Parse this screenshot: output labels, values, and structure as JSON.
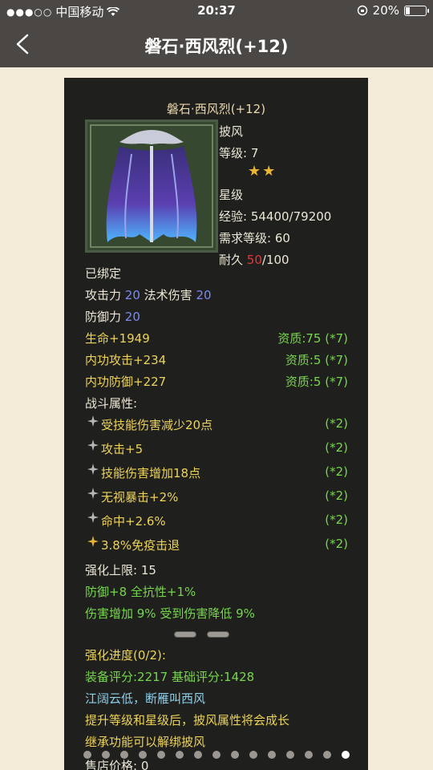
{
  "status_bar": {
    "carrier": "中国移动",
    "time": "20:37",
    "battery": "20%",
    "battery_level": 0.2
  },
  "nav": {
    "title": "磐石·西风烈(+12)"
  },
  "item": {
    "name": "磐石·西风烈(+12)",
    "type": "披风",
    "level_label": "等级:",
    "level_value": "7",
    "star_count": 2,
    "star_label": "星级",
    "exp_label": "经验:",
    "exp_value": "54400/79200",
    "req_level_label": "需求等级:",
    "req_level_value": "60",
    "durability_label": "耐久",
    "durability_current": "50",
    "durability_max": "/100",
    "bound": "已绑定",
    "atk_label": "攻击力",
    "atk_value": "20",
    "magic_label": "法术伤害",
    "magic_value": "20",
    "def_label": "防御力",
    "def_value": "20",
    "attrs": [
      {
        "name": "生命+1949",
        "quality": "资质:75 (*7)"
      },
      {
        "name": "内功攻击+234",
        "quality": "资质:5 (*7)"
      },
      {
        "name": "内功防御+227",
        "quality": "资质:5 (*7)"
      }
    ],
    "battle_header": "战斗属性:",
    "battle_attrs": [
      {
        "name": "受技能伤害减少20点",
        "mult": "(*2)",
        "icon": "gray-star-icon"
      },
      {
        "name": "攻击+5",
        "mult": "(*2)",
        "icon": "gray-star-icon"
      },
      {
        "name": "技能伤害增加18点",
        "mult": "(*2)",
        "icon": "gray-star-icon"
      },
      {
        "name": "无视暴击+2%",
        "mult": "(*2)",
        "icon": "gray-star-icon"
      },
      {
        "name": "命中+2.6%",
        "mult": "(*2)",
        "icon": "gray-star-icon"
      },
      {
        "name": "3.8%免疫击退",
        "mult": "(*2)",
        "icon": "gold-star-icon"
      }
    ],
    "enhance_limit_label": "强化上限:",
    "enhance_limit_value": "15",
    "enhance_bonus_1": "防御+8 全抗性+1%",
    "enhance_bonus_2": "伤害增加 9% 受到伤害降低 9%",
    "enhance_progress": "强化进度(0/2):",
    "score": "装备评分:2217 基础评分:1428",
    "flavor": "江阔云低，断雁叫西风",
    "note_1": "提升等级和星级后，披风属性将会成长",
    "note_2": "继承功能可以解绑披风",
    "sell_label": "售店价格:",
    "sell_value": "0"
  },
  "pager": {
    "total": 15,
    "active": 14
  }
}
